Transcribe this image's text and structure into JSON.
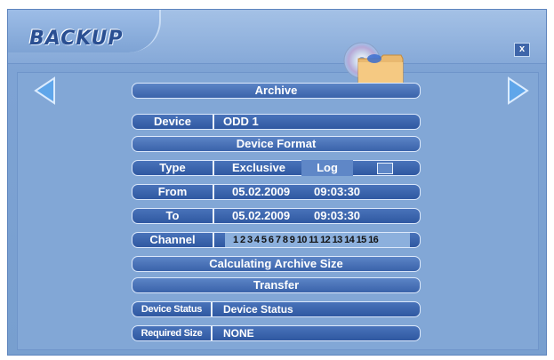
{
  "window": {
    "title": "BACKUP",
    "close_label": "x"
  },
  "colors": {
    "panel": "#82a7d6",
    "pill": "#3a63aa",
    "text": "#ffffff",
    "channel_text": "#111111"
  },
  "icons": {
    "left_nav": "triangle-left-icon",
    "right_nav": "triangle-right-icon",
    "decoration": "cd-folder-icon"
  },
  "buttons": {
    "archive": "Archive",
    "device_format": "Device Format",
    "calculating_archive_size": "Calculating Archive Size",
    "transfer": "Transfer"
  },
  "fields": {
    "device": {
      "label": "Device",
      "value": "ODD 1"
    },
    "type": {
      "label": "Type",
      "value": "Exclusive",
      "option": "Log"
    },
    "from": {
      "label": "From",
      "date": "05.02.2009",
      "time": "09:03:30"
    },
    "to": {
      "label": "To",
      "date": "05.02.2009",
      "time": "09:03:30"
    },
    "channel": {
      "label": "Channel",
      "values": "1 2 3 4 5 6 7 8 9 10 11 12 13 14 15 16"
    },
    "device_status": {
      "label": "Device Status",
      "value": "Device Status"
    },
    "required_size": {
      "label": "Required Size",
      "value": "NONE"
    }
  }
}
